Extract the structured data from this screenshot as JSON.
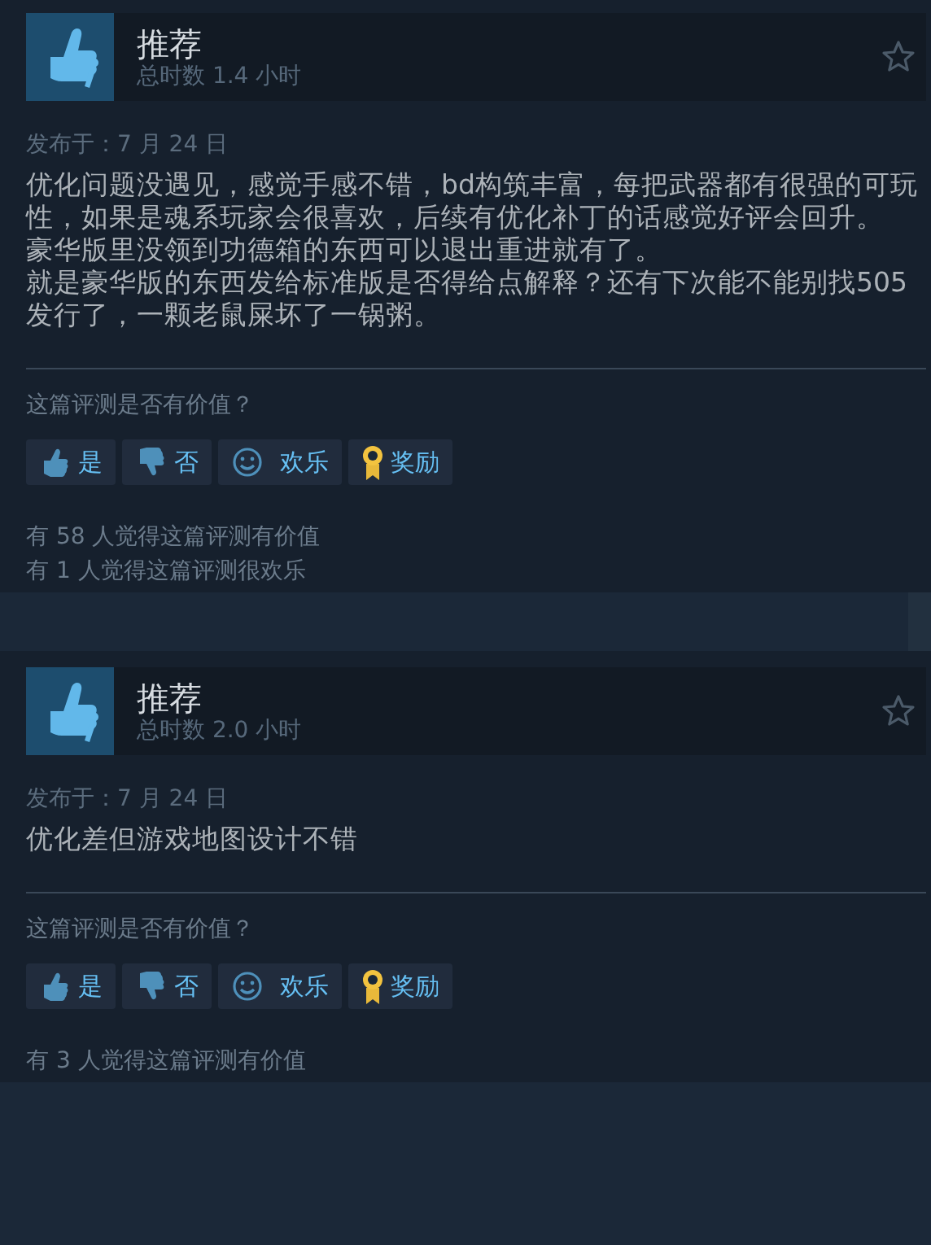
{
  "reviews": [
    {
      "verdict": "推荐",
      "hours": "总时数 1.4 小时",
      "posted": "发布于：7 月 24 日",
      "body": [
        "优化问题没遇见，感觉手感不错，bd构筑丰富，每把武器都有很强的可玩性，如果是魂系玩家会很喜欢，后续有优化补丁的话感觉好评会回升。",
        "豪华版里没领到功德箱的东西可以退出重进就有了。",
        "就是豪华版的东西发给标准版是否得给点解释？还有下次能不能别找505发行了，一颗老鼠屎坏了一锅粥。"
      ],
      "helpful_prompt": "这篇评测是否有价值？",
      "vote_buttons": [
        {
          "kind": "yes",
          "label": "是"
        },
        {
          "kind": "no",
          "label": "否"
        },
        {
          "kind": "funny",
          "label": "欢乐"
        },
        {
          "kind": "award",
          "label": "奖励"
        }
      ],
      "stats": [
        "有 58 人觉得这篇评测有价值",
        "有 1 人觉得这篇评测很欢乐"
      ]
    },
    {
      "verdict": "推荐",
      "hours": "总时数 2.0 小时",
      "posted": "发布于：7 月 24 日",
      "body": [
        "优化差但游戏地图设计不错"
      ],
      "helpful_prompt": "这篇评测是否有价值？",
      "vote_buttons": [
        {
          "kind": "yes",
          "label": "是"
        },
        {
          "kind": "no",
          "label": "否"
        },
        {
          "kind": "funny",
          "label": "欢乐"
        },
        {
          "kind": "award",
          "label": "奖励"
        }
      ],
      "stats": [
        "有 3 人觉得这篇评测有价值"
      ]
    }
  ]
}
